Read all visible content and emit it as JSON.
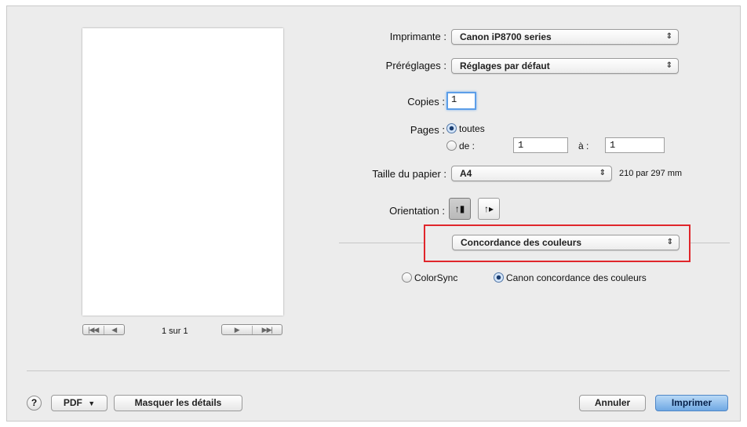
{
  "printer": {
    "label": "Imprimante :",
    "value": "Canon iP8700 series"
  },
  "presets": {
    "label": "Préréglages :",
    "value": "Réglages par défaut"
  },
  "copies": {
    "label": "Copies :",
    "value": "1"
  },
  "pages": {
    "label": "Pages :",
    "all_label": "toutes",
    "range_label": "de :",
    "from_value": "1",
    "to_label": "à :",
    "to_value": "1"
  },
  "paper_size": {
    "label": "Taille du papier :",
    "value": "A4",
    "dimensions": "210 par 297 mm"
  },
  "orientation": {
    "label": "Orientation :"
  },
  "section_popup": {
    "value": "Concordance des couleurs"
  },
  "color_matching": {
    "colorsync_label": "ColorSync",
    "canon_label": "Canon concordance des couleurs",
    "selected": "canon"
  },
  "preview_nav": {
    "first": "|◀◀",
    "prev": "◀",
    "page_indicator": "1 sur 1",
    "next": "▶",
    "last": "▶▶|"
  },
  "footer": {
    "help": "?",
    "pdf_label": "PDF",
    "hide_details_label": "Masquer les détails",
    "cancel_label": "Annuler",
    "print_label": "Imprimer"
  },
  "colors": {
    "highlight_box": "#e0262b",
    "primary_button": "#6fa8e3",
    "focus_ring": "#5c9ee8"
  }
}
